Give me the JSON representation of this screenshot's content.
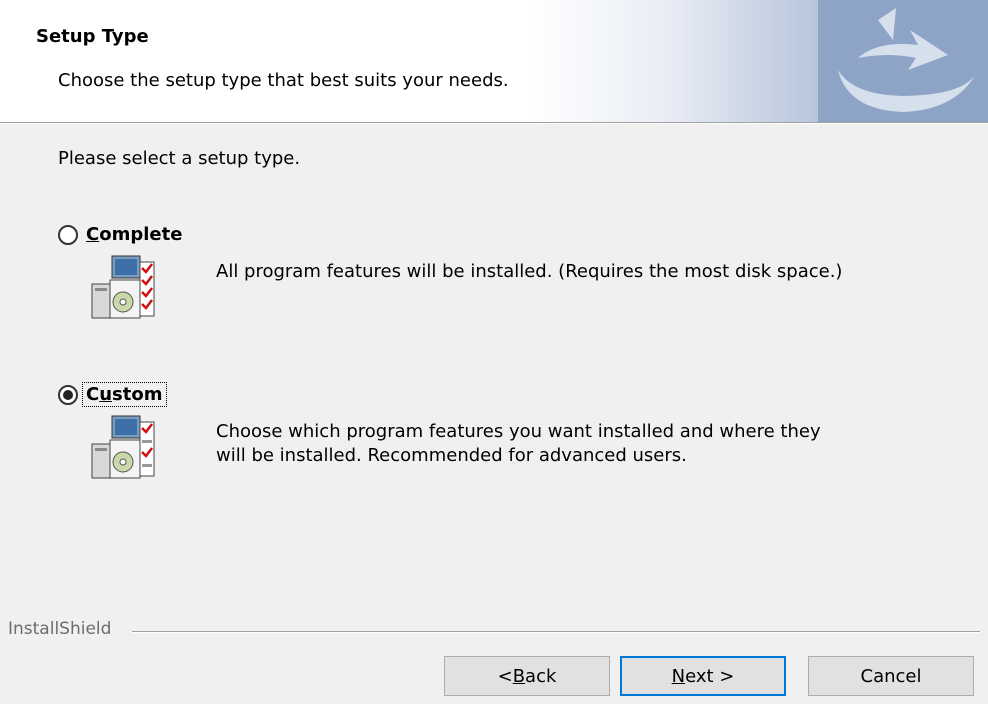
{
  "header": {
    "title": "Setup Type",
    "subtitle": "Choose the setup type that best suits your needs."
  },
  "prompt": "Please select a setup type.",
  "options": [
    {
      "label_first": "C",
      "label_rest": "omplete",
      "selected": false,
      "description": "All program features will be installed. (Requires the most disk space.)",
      "icon": "setup-computer-icon"
    },
    {
      "label_first": "C",
      "label_mid": "u",
      "label_rest": "stom",
      "selected": true,
      "description": "Choose which program features you want installed and where they will be installed. Recommended for advanced users.",
      "icon": "setup-computer-icon"
    }
  ],
  "footer": {
    "brand": "InstallShield"
  },
  "buttons": {
    "back": {
      "pre": "< ",
      "mnemonic": "B",
      "post": "ack"
    },
    "next": {
      "mnemonic": "N",
      "post": "ext >"
    },
    "cancel": "Cancel"
  },
  "colors": {
    "accent": "#0078d7",
    "banner_blue": "#8ea4c6"
  }
}
